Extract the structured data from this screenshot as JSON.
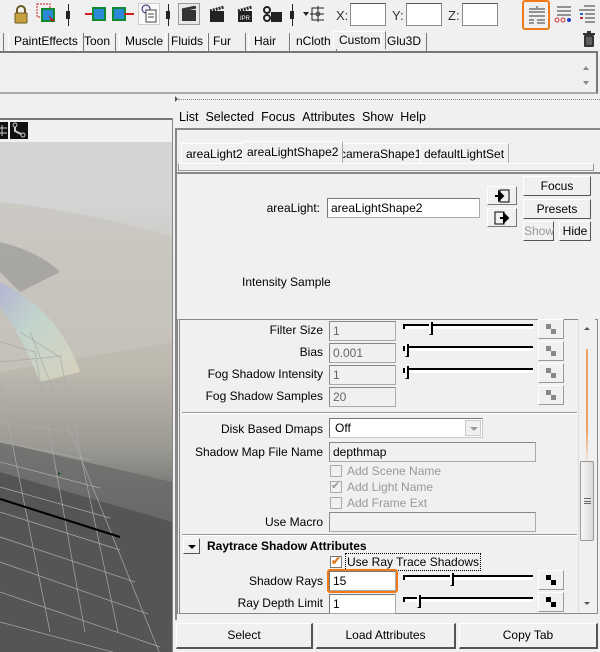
{
  "toolbar": {
    "icons": [
      "lock-icon",
      "select-highlight-icon",
      "input-connection-icon",
      "output-connection-icon",
      "history-icon",
      "render-view-icon",
      "render-icon",
      "ipr-render-icon",
      "render-settings-icon",
      "snap-transform-icon"
    ],
    "coord_labels": {
      "x": "X:",
      "y": "Y:",
      "z": "Z:"
    },
    "coord_values": {
      "x": "",
      "y": "",
      "z": ""
    },
    "right_icons": [
      "attribute-editor-icon",
      "tool-settings-icon",
      "channel-box-icon"
    ],
    "highlight_color": "#f07a18"
  },
  "shelf": {
    "tabs": [
      "PaintEffects",
      "Toon",
      "Muscle",
      "Fluids",
      "Fur",
      "Hair",
      "nCloth",
      "Custom",
      "Glu3D"
    ],
    "active_tab": "Custom"
  },
  "attribute_editor": {
    "menu": [
      "List",
      "Selected",
      "Focus",
      "Attributes",
      "Show",
      "Help"
    ],
    "node_tabs": [
      "areaLight2",
      "areaLightShape2",
      "cameraShape1",
      "defaultLightSet"
    ],
    "active_node_tab": "areaLightShape2",
    "node_label": "areaLight:",
    "node_name": "areaLightShape2",
    "buttons": {
      "focus": "Focus",
      "presets": "Presets",
      "show": "Show",
      "hide": "Hide"
    },
    "intensity_sample_label": "Intensity Sample",
    "shadow_attrs": {
      "filter_size": {
        "label": "Filter Size",
        "value": "1",
        "slider": 0.2
      },
      "bias": {
        "label": "Bias",
        "value": "0.001",
        "slider": 0.0
      },
      "fog_shadow_intensity": {
        "label": "Fog Shadow Intensity",
        "value": "1",
        "slider": 0.0
      },
      "fog_shadow_samples": {
        "label": "Fog Shadow Samples",
        "value": "20"
      },
      "disk_based_dmaps": {
        "label": "Disk Based Dmaps",
        "value": "Off"
      },
      "shadow_map_file_name": {
        "label": "Shadow Map File Name",
        "value": "depthmap"
      },
      "add_scene_name": {
        "label": "Add Scene Name",
        "checked": false
      },
      "add_light_name": {
        "label": "Add Light Name",
        "checked": true
      },
      "add_frame_ext": {
        "label": "Add Frame Ext",
        "checked": false
      },
      "use_macro": {
        "label": "Use Macro",
        "value": ""
      }
    },
    "raytrace": {
      "section_title": "Raytrace Shadow Attributes",
      "use_ray_trace_shadows": {
        "label": "Use Ray Trace Shadows",
        "checked": true
      },
      "shadow_rays": {
        "label": "Shadow Rays",
        "value": "15",
        "slider": 0.37
      },
      "ray_depth_limit": {
        "label": "Ray Depth Limit",
        "value": "1",
        "slider": 0.1
      }
    },
    "footer": {
      "select": "Select",
      "load_attributes": "Load Attributes",
      "copy_tab": "Copy Tab"
    }
  }
}
